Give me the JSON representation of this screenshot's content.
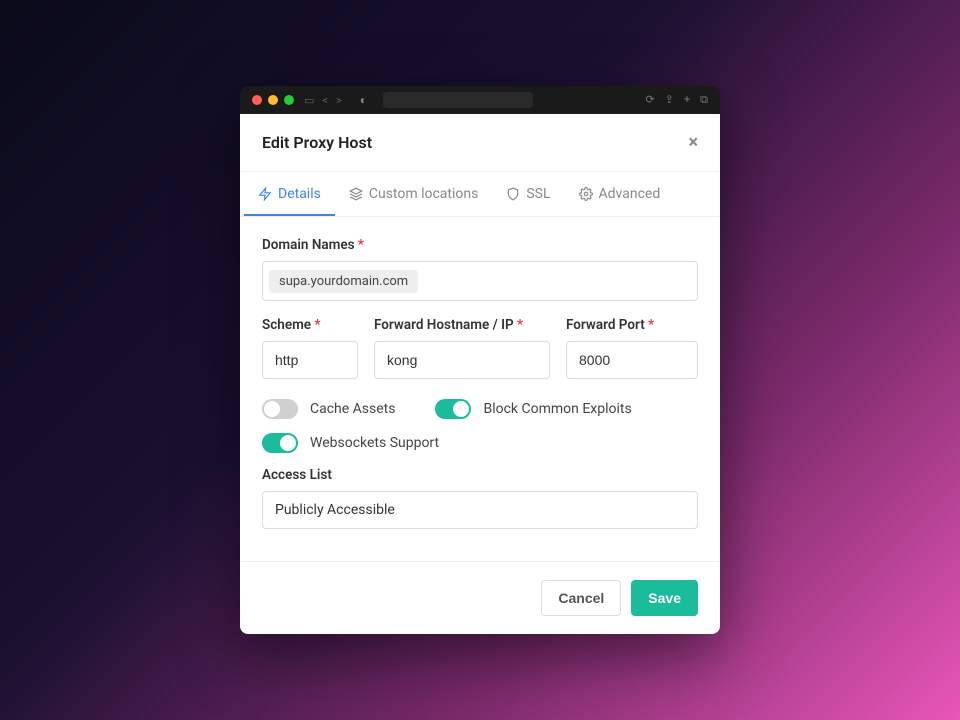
{
  "modal": {
    "title": "Edit Proxy Host"
  },
  "tabs": [
    {
      "label": "Details",
      "active": true
    },
    {
      "label": "Custom locations",
      "active": false
    },
    {
      "label": "SSL",
      "active": false
    },
    {
      "label": "Advanced",
      "active": false
    }
  ],
  "form": {
    "domain_names_label": "Domain Names",
    "domain_chip": "supa.yourdomain.com",
    "scheme_label": "Scheme",
    "scheme_value": "http",
    "hostname_label": "Forward Hostname / IP",
    "hostname_value": "kong",
    "port_label": "Forward Port",
    "port_value": "8000",
    "cache_assets_label": "Cache Assets",
    "cache_assets_on": false,
    "block_exploits_label": "Block Common Exploits",
    "block_exploits_on": true,
    "websockets_label": "Websockets Support",
    "websockets_on": true,
    "access_list_label": "Access List",
    "access_list_value": "Publicly Accessible"
  },
  "buttons": {
    "cancel": "Cancel",
    "save": "Save"
  }
}
